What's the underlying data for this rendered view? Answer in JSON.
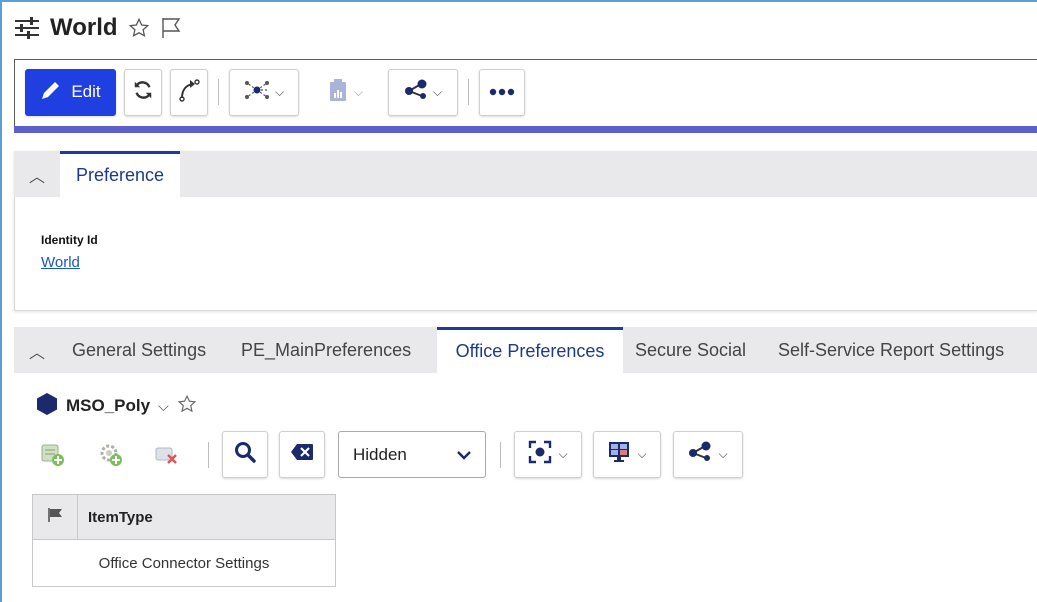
{
  "header": {
    "title": "World",
    "icons": [
      "sliders-icon",
      "star-outline-icon",
      "flag-outline-icon"
    ]
  },
  "toolbar": {
    "edit_label": "Edit",
    "buttons": [
      "edit-button",
      "refresh-button",
      "workflow-button",
      "network-dropdown",
      "report-dropdown",
      "share-dropdown",
      "more-button"
    ]
  },
  "preference_panel": {
    "tab_label": "Preference",
    "field_label": "Identity Id",
    "field_value": "World"
  },
  "settings_panel": {
    "tabs": [
      {
        "label": "General Settings"
      },
      {
        "label": "PE_MainPreferences"
      },
      {
        "label": "Office Preferences"
      },
      {
        "label": "Secure Social"
      },
      {
        "label": "Self-Service Report Settings"
      }
    ],
    "active_tab": "Office Preferences",
    "module_name": "MSO_Poly",
    "filter_select": {
      "value": "Hidden"
    },
    "grid": {
      "columns": [
        "ItemType"
      ],
      "rows": [
        [
          "Office Connector Settings"
        ]
      ]
    }
  },
  "colors": {
    "accent_blue": "#1f3fe0",
    "toolbar_accent": "#5b61c8",
    "tab_text": "#1d3a8a",
    "link": "#1a56c4"
  }
}
